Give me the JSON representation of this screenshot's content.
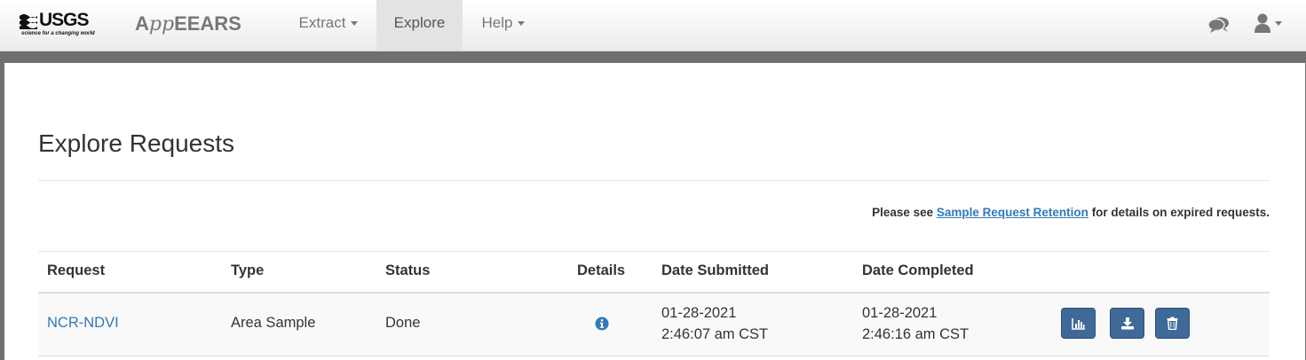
{
  "header": {
    "logo": {
      "text": "USGS",
      "tagline": "science for a changing world"
    },
    "brand": {
      "prefix": "A",
      "middle": "pp",
      "suffix": "EEARS"
    },
    "nav": [
      {
        "label": "Extract",
        "dropdown": true
      },
      {
        "label": "Explore",
        "active": true
      },
      {
        "label": "Help",
        "dropdown": true
      }
    ],
    "icons": [
      "comments-icon",
      "user-icon"
    ]
  },
  "main": {
    "title": "Explore Requests",
    "notice": {
      "prefix": "Please see",
      "link": "Sample Request Retention",
      "suffix": "for details on expired requests."
    },
    "table": {
      "columns": [
        "Request",
        "Type",
        "Status",
        "Details",
        "Date Submitted",
        "Date Completed"
      ],
      "rows": [
        {
          "request": "NCR-NDVI",
          "type": "Area Sample",
          "status": "Done",
          "details_icon": "info-icon",
          "submitted_date": "01-28-2021",
          "submitted_time": "2:46:07 am CST",
          "completed_date": "01-28-2021",
          "completed_time": "2:46:16 am CST",
          "actions": [
            "chart-icon",
            "download-icon",
            "trash-icon"
          ]
        }
      ]
    }
  },
  "colors": {
    "link": "#337ab7",
    "action_button": "#3f6a97",
    "frame": "#707070",
    "nav_text": "#777777"
  }
}
